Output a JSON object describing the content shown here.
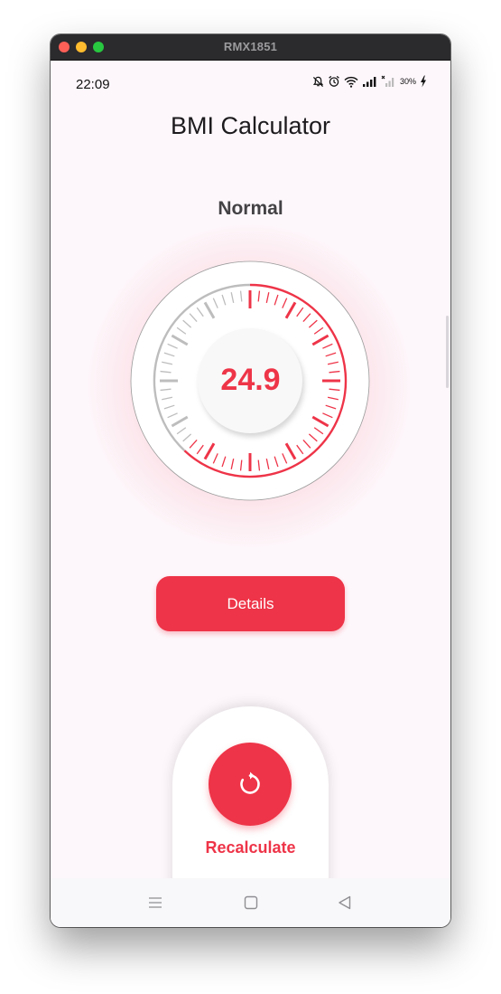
{
  "window": {
    "title": "RMX1851"
  },
  "status_bar": {
    "time": "22:09",
    "battery": "30%",
    "icons": [
      "mute-bell-icon",
      "alarm-icon",
      "wifi-icon",
      "signal-icon",
      "no-signal-icon",
      "battery-charging-icon"
    ]
  },
  "app": {
    "title": "BMI Calculator"
  },
  "result": {
    "status": "Normal",
    "bmi": "24.9",
    "gauge_fraction": 0.62,
    "accent_color": "#ee3448",
    "inactive_color": "#bdbdbd"
  },
  "details_button": {
    "label": "Details"
  },
  "recalculate": {
    "label": "Recalculate",
    "icon": "refresh-icon"
  },
  "nav_bar": {
    "icons": [
      "menu-icon",
      "home-square-icon",
      "back-triangle-icon"
    ]
  }
}
